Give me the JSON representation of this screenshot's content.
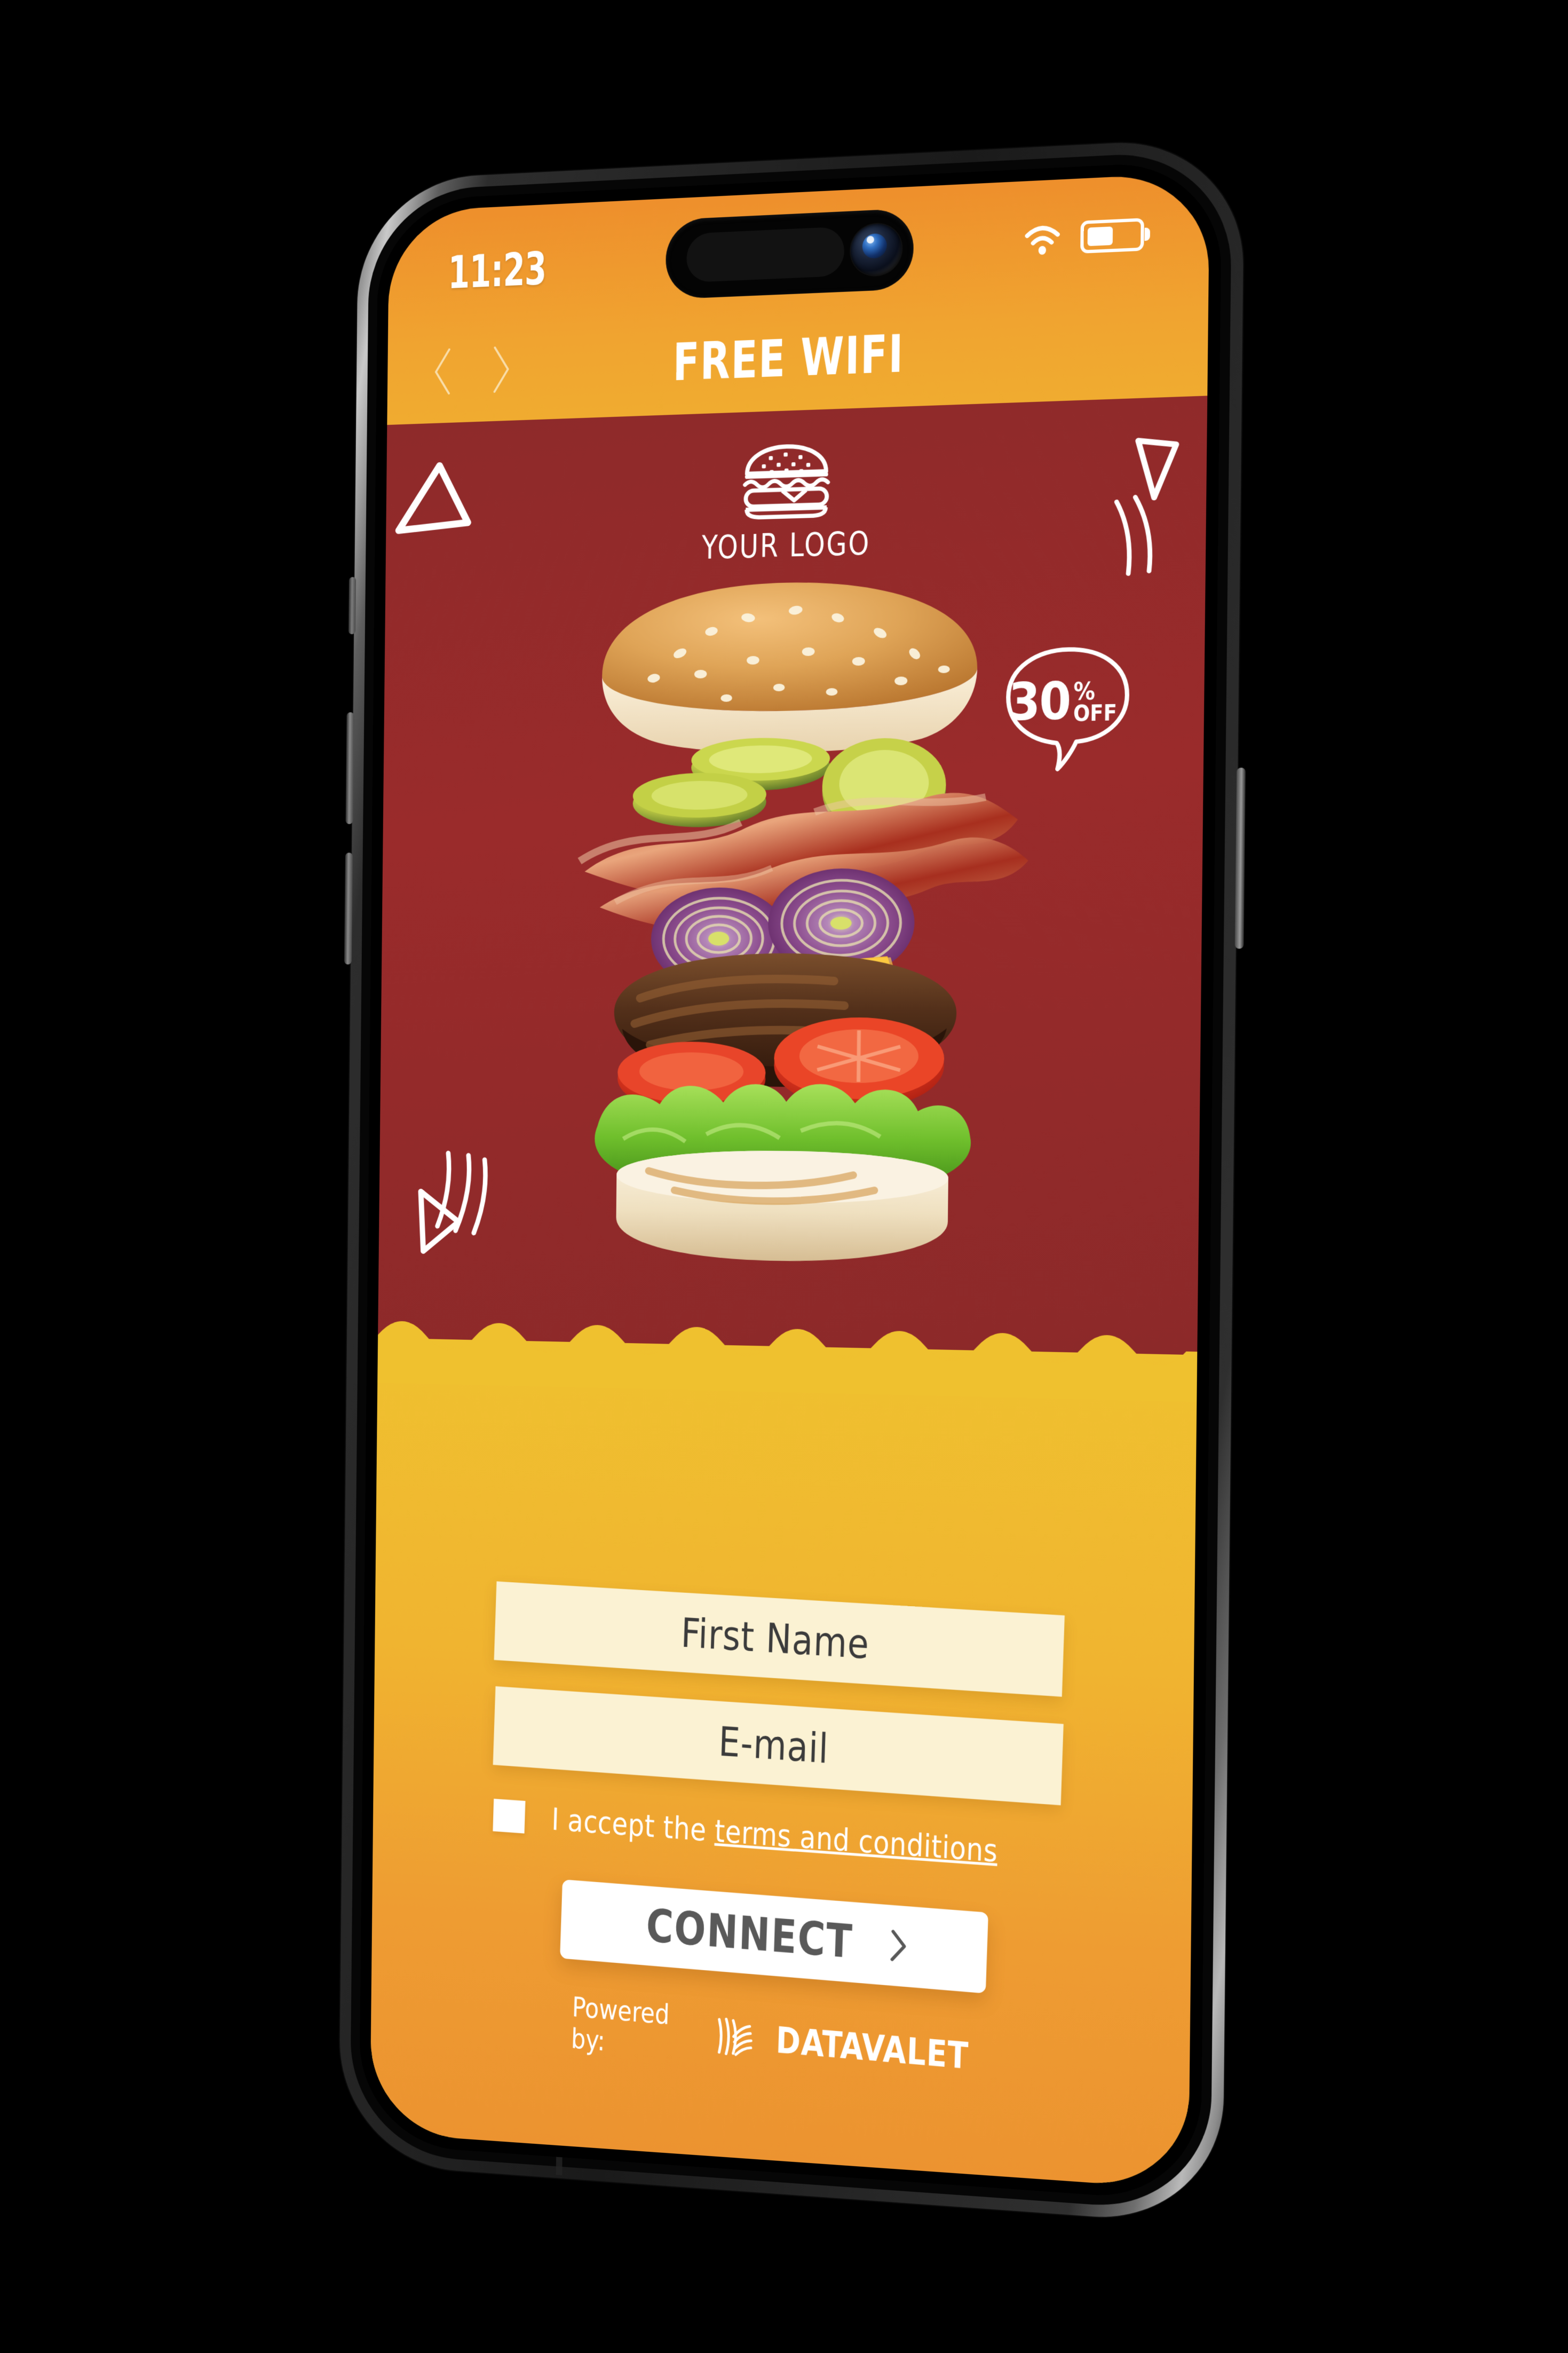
{
  "statusbar": {
    "time": "11:23",
    "wifi_icon": "wifi-icon",
    "battery_icon": "battery-icon",
    "battery_level_pct": 45
  },
  "header": {
    "title": "FREE WIFI",
    "back_icon": "chevron-left-icon",
    "forward_icon": "chevron-right-icon"
  },
  "brand": {
    "logo_icon": "burger-icon",
    "logo_text": "YOUR LOGO"
  },
  "promo": {
    "badge_number": "30",
    "badge_percent": "%",
    "badge_off": "OFF",
    "hero_image": "deconstructed-burger-photo",
    "doodle_icons": [
      "triangle-doodle-icon",
      "triangle-doodle-icon",
      "triangle-doodle-icon",
      "speed-lines-doodle-icon",
      "speed-lines-doodle-icon"
    ]
  },
  "form": {
    "first_name_placeholder": "First Name",
    "first_name_value": "",
    "email_placeholder": "E-mail",
    "email_value": "",
    "terms_prefix": "I accept the ",
    "terms_link": "terms and conditions",
    "terms_checked": false,
    "connect_label": "CONNECT",
    "connect_icon": "chevron-right-icon"
  },
  "footer": {
    "powered_by": "Powered by:",
    "vendor_icon": "datavalet-swirl-icon",
    "vendor_name": "DATAVALET"
  },
  "theme": {
    "red": "#8E2A2A",
    "gold": "#EFC12F",
    "orange": "#EE9A33",
    "cream": "#FBF2D3",
    "white": "#FFFFFF",
    "connect_text": "#595959"
  }
}
